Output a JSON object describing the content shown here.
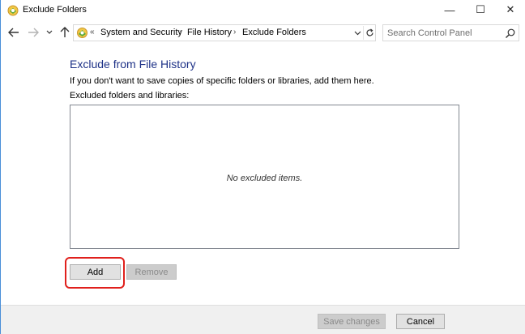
{
  "window": {
    "title": "Exclude Folders",
    "minimize_glyph": "—",
    "maximize_glyph": "☐",
    "close_glyph": "✕"
  },
  "nav": {
    "back_icon": "arrow-left-icon",
    "forward_icon": "arrow-right-icon",
    "recent_icon": "chevron-down-icon",
    "up_icon": "arrow-up-icon"
  },
  "address": {
    "overflow": "«",
    "breadcrumbs": [
      {
        "label": "System and Security"
      },
      {
        "label": "File History"
      },
      {
        "label": "Exclude Folders"
      }
    ],
    "separator": "›"
  },
  "search": {
    "placeholder": "Search Control Panel"
  },
  "content": {
    "heading": "Exclude from File History",
    "description": "If you don't want to save copies of specific folders or libraries, add them here.",
    "list_label": "Excluded folders and libraries:",
    "empty_message": "No excluded items.",
    "add_label": "Add",
    "remove_label": "Remove"
  },
  "footer": {
    "save_label": "Save changes",
    "cancel_label": "Cancel"
  },
  "colors": {
    "heading": "#1e3287",
    "highlight": "#e0201c",
    "window_border": "#4a8fd8"
  }
}
